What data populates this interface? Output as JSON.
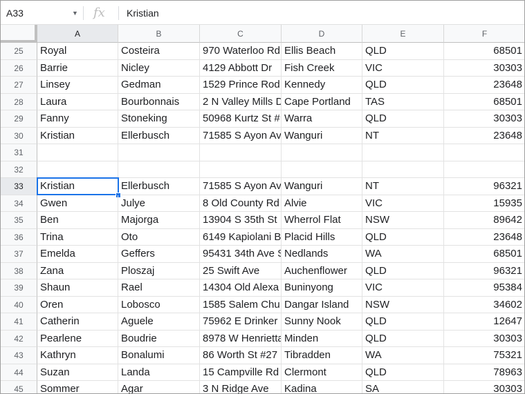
{
  "formula_bar": {
    "name_box": "A33",
    "fx_label": "fx",
    "value": "Kristian"
  },
  "columns": [
    "A",
    "B",
    "C",
    "D",
    "E",
    "F"
  ],
  "selected_cell": "A33",
  "rows": [
    {
      "n": "25",
      "cells": [
        "Royal",
        "Costeira",
        "970 Waterloo Rd",
        "Ellis Beach",
        "QLD",
        "68501"
      ]
    },
    {
      "n": "26",
      "cells": [
        "Barrie",
        "Nicley",
        "4129 Abbott Dr",
        "Fish Creek",
        "VIC",
        "30303"
      ]
    },
    {
      "n": "27",
      "cells": [
        "Linsey",
        "Gedman",
        "1529 Prince Rod",
        "Kennedy",
        "QLD",
        "23648"
      ]
    },
    {
      "n": "28",
      "cells": [
        "Laura",
        "Bourbonnais",
        "2 N Valley Mills D",
        "Cape Portland",
        "TAS",
        "68501"
      ]
    },
    {
      "n": "29",
      "cells": [
        "Fanny",
        "Stoneking",
        "50968 Kurtz St #",
        "Warra",
        "QLD",
        "30303"
      ]
    },
    {
      "n": "30",
      "cells": [
        "Kristian",
        "Ellerbusch",
        "71585 S Ayon Av",
        "Wanguri",
        "NT",
        "23648"
      ]
    },
    {
      "n": "31",
      "cells": [
        "",
        "",
        "",
        "",
        "",
        ""
      ]
    },
    {
      "n": "32",
      "cells": [
        "",
        "",
        "",
        "",
        "",
        ""
      ]
    },
    {
      "n": "33",
      "cells": [
        "Kristian",
        "Ellerbusch",
        "71585 S Ayon Av",
        "Wanguri",
        "NT",
        "96321"
      ]
    },
    {
      "n": "34",
      "cells": [
        "Gwen",
        "Julye",
        "8 Old County Rd",
        "Alvie",
        "VIC",
        "15935"
      ]
    },
    {
      "n": "35",
      "cells": [
        "Ben",
        "Majorga",
        "13904 S 35th St",
        "Wherrol Flat",
        "NSW",
        "89642"
      ]
    },
    {
      "n": "36",
      "cells": [
        "Trina",
        "Oto",
        "6149 Kapiolani B",
        "Placid Hills",
        "QLD",
        "23648"
      ]
    },
    {
      "n": "37",
      "cells": [
        "Emelda",
        "Geffers",
        "95431 34th Ave S",
        "Nedlands",
        "WA",
        "68501"
      ]
    },
    {
      "n": "38",
      "cells": [
        "Zana",
        "Ploszaj",
        "25 Swift Ave",
        "Auchenflower",
        "QLD",
        "96321"
      ]
    },
    {
      "n": "39",
      "cells": [
        "Shaun",
        "Rael",
        "14304 Old Alexa",
        "Buninyong",
        "VIC",
        "95384"
      ]
    },
    {
      "n": "40",
      "cells": [
        "Oren",
        "Lobosco",
        "1585 Salem Chu",
        "Dangar Island",
        "NSW",
        "34602"
      ]
    },
    {
      "n": "41",
      "cells": [
        "Catherin",
        "Aguele",
        "75962 E Drinker",
        "Sunny Nook",
        "QLD",
        "12647"
      ]
    },
    {
      "n": "42",
      "cells": [
        "Pearlene",
        "Boudrie",
        "8978 W Henrietta",
        "Minden",
        "QLD",
        "30303"
      ]
    },
    {
      "n": "43",
      "cells": [
        "Kathryn",
        "Bonalumi",
        "86 Worth St #27",
        "Tibradden",
        "WA",
        "75321"
      ]
    },
    {
      "n": "44",
      "cells": [
        "Suzan",
        "Landa",
        "15 Campville Rd",
        "Clermont",
        "QLD",
        "78963"
      ]
    },
    {
      "n": "45",
      "cells": [
        "Sommer",
        "Agar",
        "3 N Ridge Ave",
        "Kadina",
        "SA",
        "30303"
      ]
    }
  ]
}
